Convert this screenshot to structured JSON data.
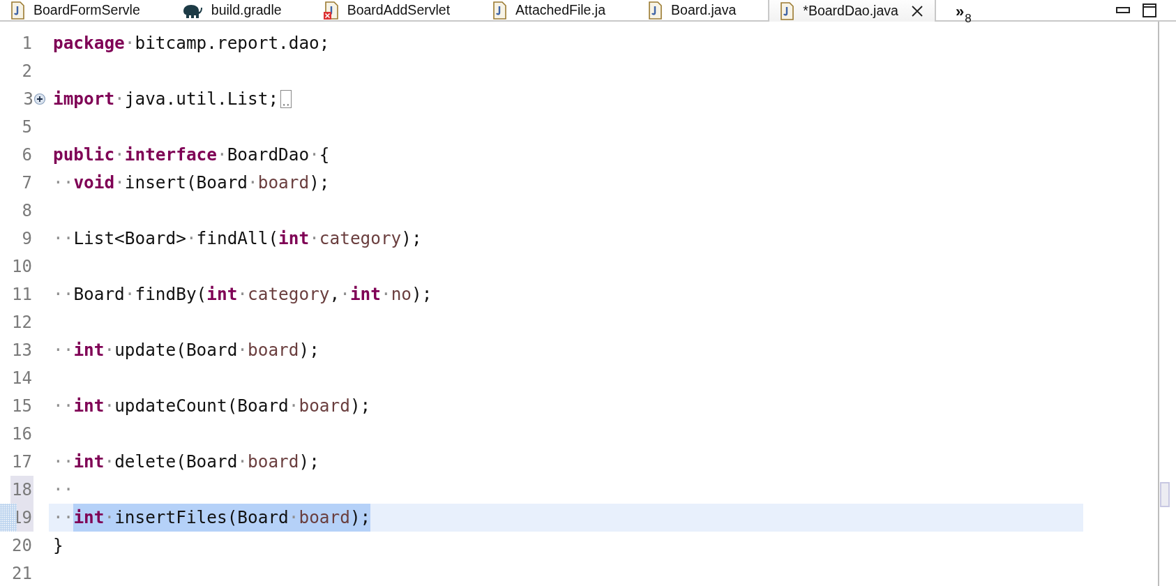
{
  "tabs": [
    {
      "label": "BoardFormServle",
      "kind": "java",
      "selected": false
    },
    {
      "label": "build.gradle",
      "kind": "gradle",
      "selected": false
    },
    {
      "label": "BoardAddServlet",
      "kind": "java-error",
      "selected": false
    },
    {
      "label": "AttachedFile.ja",
      "kind": "java",
      "selected": false
    },
    {
      "label": "Board.java",
      "kind": "java",
      "selected": false
    },
    {
      "label": "*BoardDao.java",
      "kind": "java",
      "selected": true
    }
  ],
  "overflow": {
    "glyph": "»",
    "count": "8"
  },
  "lines": [
    {
      "number": "1",
      "tokens": [
        {
          "kind": "keyword",
          "text": "package"
        },
        {
          "kind": "ws",
          "text": "·"
        },
        {
          "kind": "plain",
          "text": "bitcamp.report.dao;"
        }
      ]
    },
    {
      "number": "2"
    },
    {
      "number": "3",
      "folded": true,
      "tokens": [
        {
          "kind": "keyword",
          "text": "import"
        },
        {
          "kind": "ws",
          "text": "·"
        },
        {
          "kind": "plain",
          "text": "java.util.List;"
        }
      ]
    },
    {
      "number": "5"
    },
    {
      "number": "6",
      "tokens": [
        {
          "kind": "keyword",
          "text": "public"
        },
        {
          "kind": "ws",
          "text": "·"
        },
        {
          "kind": "keyword",
          "text": "interface"
        },
        {
          "kind": "ws",
          "text": "·"
        },
        {
          "kind": "plain",
          "text": "BoardDao"
        },
        {
          "kind": "ws",
          "text": "·"
        },
        {
          "kind": "plain",
          "text": "{"
        }
      ]
    },
    {
      "number": "7",
      "tokens": [
        {
          "kind": "ws",
          "text": "··"
        },
        {
          "kind": "keyword",
          "text": "void"
        },
        {
          "kind": "ws",
          "text": "·"
        },
        {
          "kind": "plain",
          "text": "insert(Board"
        },
        {
          "kind": "ws",
          "text": "·"
        },
        {
          "kind": "param",
          "text": "board"
        },
        {
          "kind": "plain",
          "text": ");"
        }
      ]
    },
    {
      "number": "8"
    },
    {
      "number": "9",
      "tokens": [
        {
          "kind": "ws",
          "text": "··"
        },
        {
          "kind": "plain",
          "text": "List<Board>"
        },
        {
          "kind": "ws",
          "text": "·"
        },
        {
          "kind": "plain",
          "text": "findAll("
        },
        {
          "kind": "keyword",
          "text": "int"
        },
        {
          "kind": "ws",
          "text": "·"
        },
        {
          "kind": "param",
          "text": "category"
        },
        {
          "kind": "plain",
          "text": ");"
        }
      ]
    },
    {
      "number": "10"
    },
    {
      "number": "11",
      "tokens": [
        {
          "kind": "ws",
          "text": "··"
        },
        {
          "kind": "plain",
          "text": "Board"
        },
        {
          "kind": "ws",
          "text": "·"
        },
        {
          "kind": "plain",
          "text": "findBy("
        },
        {
          "kind": "keyword",
          "text": "int"
        },
        {
          "kind": "ws",
          "text": "·"
        },
        {
          "kind": "param",
          "text": "category"
        },
        {
          "kind": "plain",
          "text": ","
        },
        {
          "kind": "ws",
          "text": "·"
        },
        {
          "kind": "keyword",
          "text": "int"
        },
        {
          "kind": "ws",
          "text": "·"
        },
        {
          "kind": "param",
          "text": "no"
        },
        {
          "kind": "plain",
          "text": ");"
        }
      ]
    },
    {
      "number": "12"
    },
    {
      "number": "13",
      "tokens": [
        {
          "kind": "ws",
          "text": "··"
        },
        {
          "kind": "keyword",
          "text": "int"
        },
        {
          "kind": "ws",
          "text": "·"
        },
        {
          "kind": "plain",
          "text": "update(Board"
        },
        {
          "kind": "ws",
          "text": "·"
        },
        {
          "kind": "param",
          "text": "board"
        },
        {
          "kind": "plain",
          "text": ");"
        }
      ]
    },
    {
      "number": "14"
    },
    {
      "number": "15",
      "tokens": [
        {
          "kind": "ws",
          "text": "··"
        },
        {
          "kind": "keyword",
          "text": "int"
        },
        {
          "kind": "ws",
          "text": "·"
        },
        {
          "kind": "plain",
          "text": "updateCount(Board"
        },
        {
          "kind": "ws",
          "text": "·"
        },
        {
          "kind": "param",
          "text": "board"
        },
        {
          "kind": "plain",
          "text": ");"
        }
      ]
    },
    {
      "number": "16"
    },
    {
      "number": "17",
      "tokens": [
        {
          "kind": "ws",
          "text": "··"
        },
        {
          "kind": "keyword",
          "text": "int"
        },
        {
          "kind": "ws",
          "text": "·"
        },
        {
          "kind": "plain",
          "text": "delete(Board"
        },
        {
          "kind": "ws",
          "text": "·"
        },
        {
          "kind": "param",
          "text": "board"
        },
        {
          "kind": "plain",
          "text": ");"
        }
      ]
    },
    {
      "number": "18",
      "marked": true,
      "tokens": [
        {
          "kind": "ws",
          "text": "··"
        }
      ]
    },
    {
      "number": "19",
      "marked": true,
      "current": true,
      "tokens": [
        {
          "kind": "ws",
          "text": "··"
        },
        {
          "kind": "keyword",
          "text": "int",
          "selected": true
        },
        {
          "kind": "ws",
          "text": "·",
          "selected": true
        },
        {
          "kind": "plain",
          "text": "insertFiles(Board",
          "selected": true
        },
        {
          "kind": "ws",
          "text": "·",
          "selected": true
        },
        {
          "kind": "param",
          "text": "board",
          "selected": true
        },
        {
          "kind": "plain",
          "text": ");",
          "selected": true
        }
      ]
    },
    {
      "number": "20",
      "tokens": [
        {
          "kind": "plain",
          "text": "}"
        }
      ]
    },
    {
      "number": "21"
    }
  ]
}
